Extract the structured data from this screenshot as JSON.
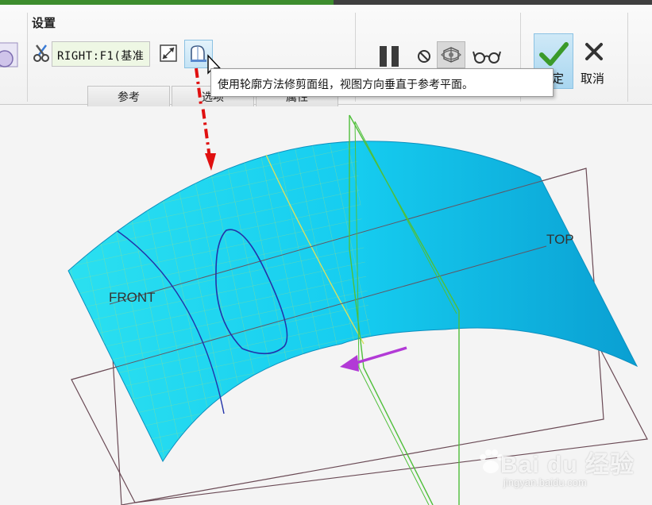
{
  "ribbon": {
    "group_label": "设置",
    "reference_field_value": "RIGHT:F1(基准",
    "tabs": [
      {
        "label": "参考"
      },
      {
        "label": "选项"
      },
      {
        "label": "属性"
      }
    ],
    "tooltip": "使用轮廓方法修剪面组，视图方向垂直于参考平面。",
    "ok_label": "确定",
    "cancel_label": "取消"
  },
  "icons": {
    "trim_tool": "scissors-icon",
    "flip": "flip-direction-icon",
    "silhouette": "silhouette-trim-icon",
    "pause": "pause-icon",
    "no_preview": "no-preview-icon",
    "preview": "preview-geometry-icon",
    "verify": "glasses-icon",
    "ok": "check-icon",
    "cancel": "x-icon"
  },
  "viewport": {
    "plane_front": "FRONT",
    "plane_top": "TOP"
  },
  "watermark": {
    "brand": "Bai du 经验",
    "url": "jingyan.baidu.com"
  },
  "colors": {
    "surface": "#22d3f0",
    "surface_dark": "#0aa9d6",
    "plane_lines": "#6a4a55",
    "green_curve": "#4fbf3a",
    "blue_curve": "#2233aa",
    "arrow_red": "#e01010",
    "arrow_purple": "#b23ad6",
    "ok_check": "#3b9a2a"
  }
}
